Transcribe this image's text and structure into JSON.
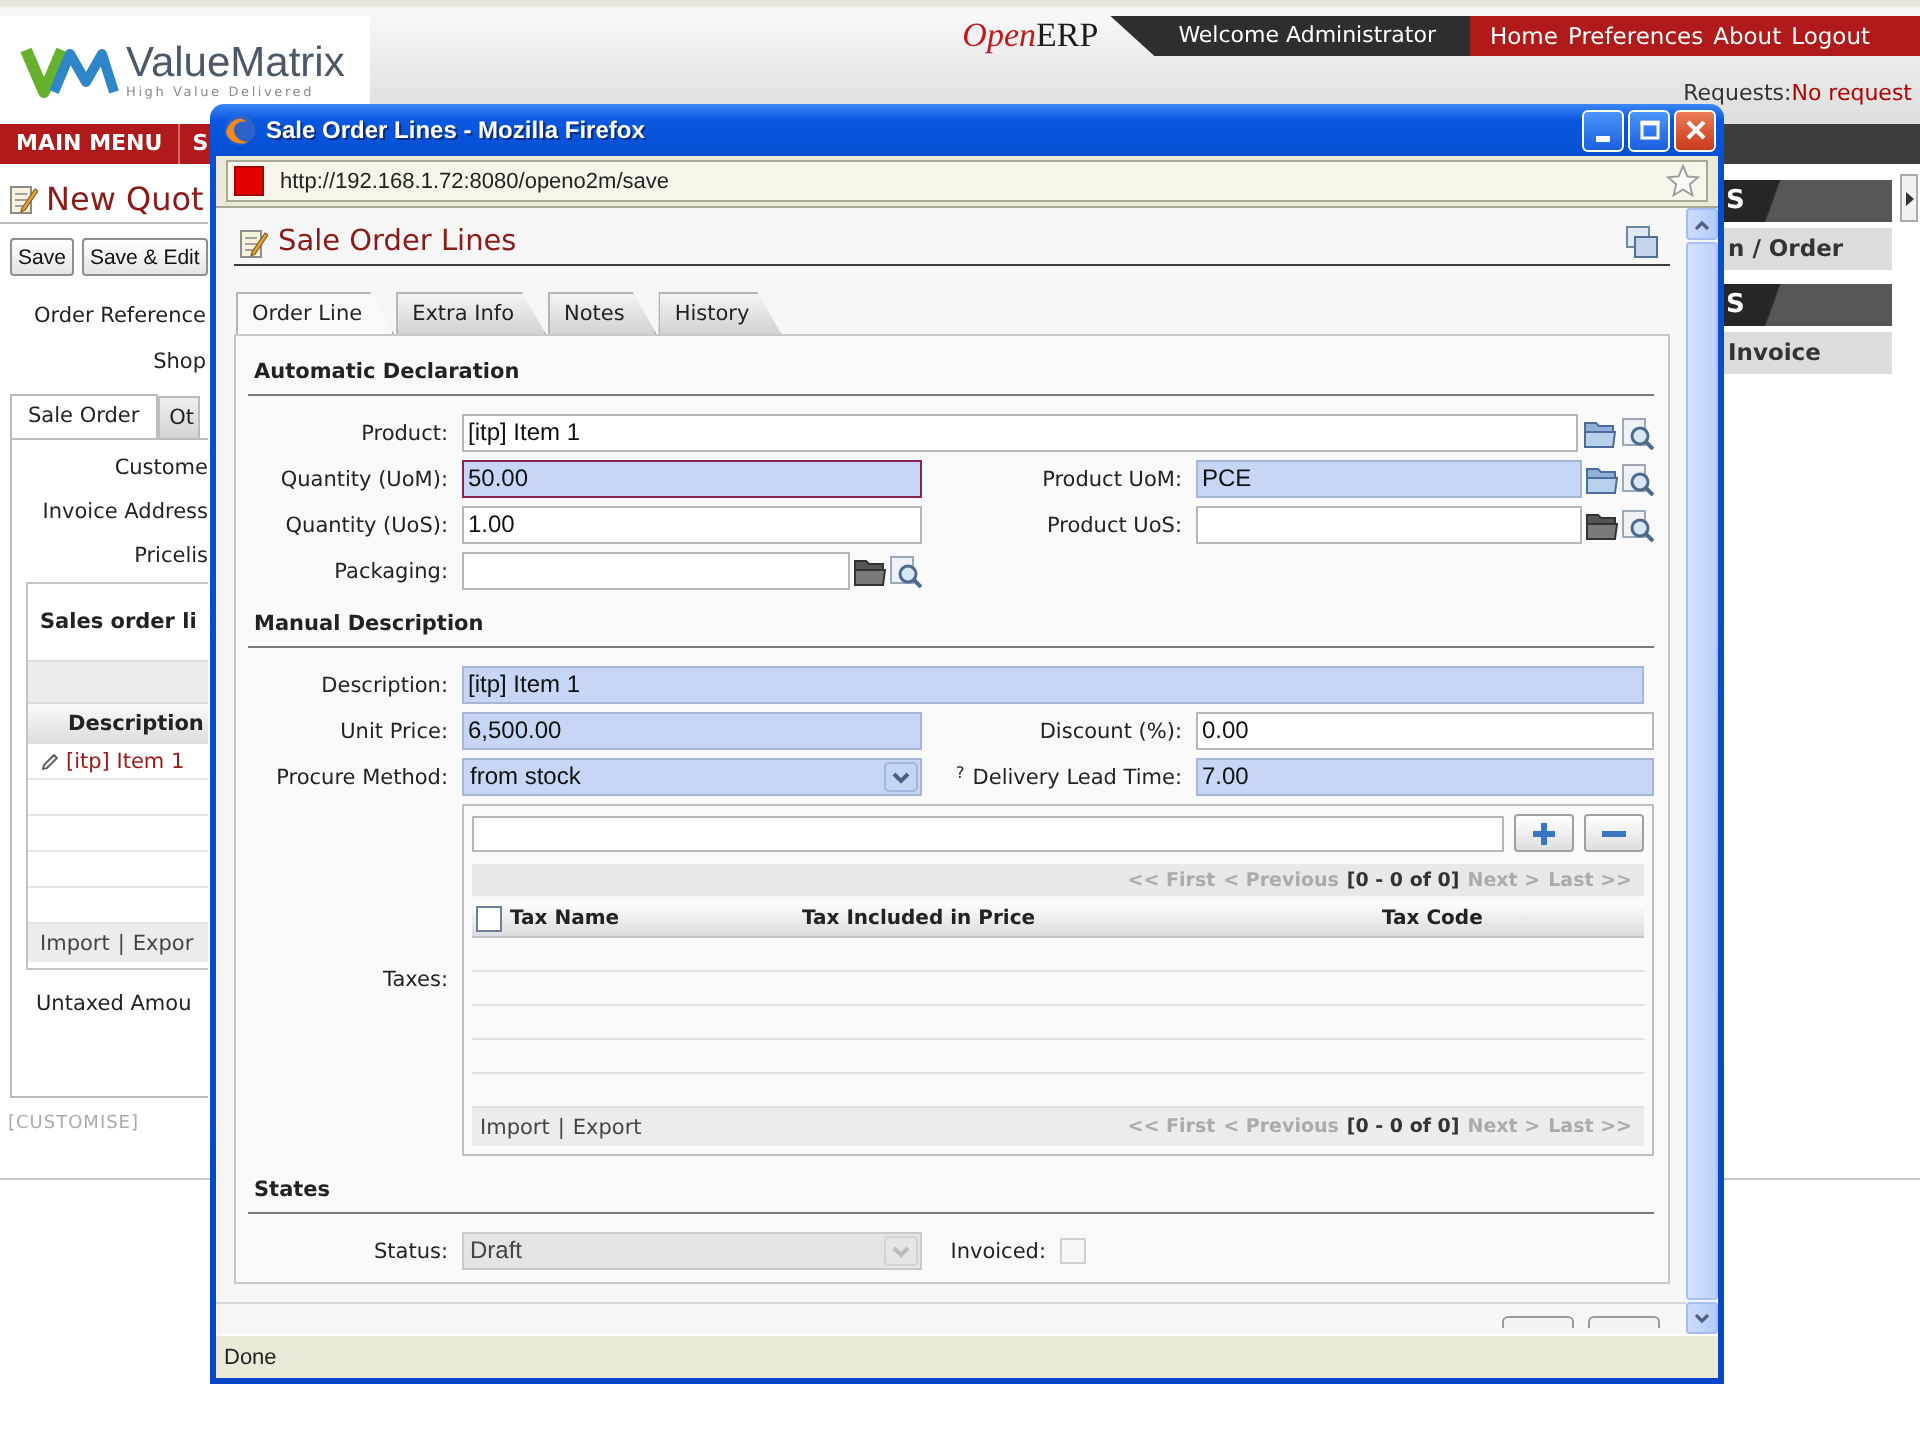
{
  "background_page": {
    "logo": {
      "name": "ValueMatrix",
      "tagline": "High Value Delivered"
    },
    "brand": [
      "Open",
      "ERP"
    ],
    "welcome": "Welcome Administrator",
    "nav_links": [
      "Home",
      "Preferences",
      "About",
      "Logout"
    ],
    "requests": {
      "label": "Requests:",
      "value": "No request"
    },
    "main_menu": [
      "MAIN MENU",
      "S"
    ],
    "title": "New Quot",
    "toolbar": [
      "Save",
      "Save & Edit"
    ],
    "header_fields": [
      "Order Reference",
      "Shop"
    ],
    "tabs": [
      {
        "label": "Sale Order",
        "selected": true
      },
      {
        "label": "Ot",
        "selected": false
      }
    ],
    "fields": [
      "Custome",
      "Invoice Address",
      "Pricelis"
    ],
    "order_lines": {
      "title": "Sales order li",
      "column": "Description",
      "rows": [
        "[itp] Item 1"
      ],
      "import": "Import",
      "separator": "|",
      "export": "Expor"
    },
    "untaxed": "Untaxed Amou",
    "customise": "[CUSTOMISE]",
    "sidebar": [
      {
        "heading": "S",
        "item": "n / Order"
      },
      {
        "heading": "S",
        "item": "Invoice"
      }
    ]
  },
  "popup": {
    "title": "Sale Order Lines - Mozilla Firefox",
    "url": "http://192.168.1.72:8080/openo2m/save",
    "heading": "Sale Order Lines",
    "tabs": [
      {
        "label": "Order Line",
        "selected": true
      },
      {
        "label": "Extra Info",
        "selected": false
      },
      {
        "label": "Notes",
        "selected": false
      },
      {
        "label": "History",
        "selected": false
      }
    ],
    "sections": [
      {
        "title": "Automatic Declaration",
        "rows": [
          {
            "full": {
              "label": "Product:",
              "kind": "many2one",
              "value": "[itp] Item 1",
              "required": false,
              "focused": false,
              "disabled": false
            }
          },
          {
            "left": {
              "label": "Quantity (UoM):",
              "kind": "char",
              "value": "50.00",
              "required": true,
              "focused": true,
              "disabled": false
            },
            "right": {
              "label": "Product UoM:",
              "kind": "many2one",
              "value": "PCE",
              "required": true,
              "focused": false,
              "disabled": false
            }
          },
          {
            "left": {
              "label": "Quantity (UoS):",
              "kind": "char",
              "value": "1.00",
              "required": false,
              "focused": false,
              "disabled": false
            },
            "right": {
              "label": "Product UoS:",
              "kind": "many2one",
              "required": false,
              "focused": false,
              "disabled": false
            }
          },
          {
            "left": {
              "label": "Packaging:",
              "kind": "many2one",
              "required": false,
              "focused": false,
              "disabled": false
            }
          }
        ]
      },
      {
        "title": "Manual Description",
        "rows": [
          {
            "full": {
              "label": "Description:",
              "kind": "char",
              "value": "[itp] Item 1",
              "required": true,
              "focused": false,
              "disabled": false
            }
          },
          {
            "left": {
              "label": "Unit Price:",
              "kind": "char",
              "value": "6,500.00",
              "required": true,
              "focused": false,
              "disabled": false
            },
            "right": {
              "label": "Discount (%):",
              "kind": "char",
              "value": "0.00",
              "required": false,
              "focused": false,
              "disabled": false
            }
          },
          {
            "left": {
              "label": "Procure Method:",
              "kind": "select",
              "value": "from stock",
              "required": true,
              "focused": false,
              "disabled": false
            },
            "right": {
              "label": "Delivery Lead Time:",
              "help_mark": "?",
              "kind": "char",
              "value": "7.00",
              "required": true,
              "focused": false,
              "disabled": false
            }
          },
          {
            "full": {
              "label": "Taxes:",
              "kind": "one2many",
              "select_all_checked": false,
              "top_pager": {
                "links_before": [
                  {
                    "text": "<< First",
                    "disabled": true
                  },
                  {
                    "text": "< Previous",
                    "disabled": true
                  }
                ],
                "range": "[0 - 0 of 0]",
                "links_after": [
                  {
                    "text": "Next >",
                    "disabled": true
                  },
                  {
                    "text": "Last >>",
                    "disabled": true
                  }
                ]
              },
              "columns": [
                "Tax Name",
                "Tax Included in Price",
                "Tax Code"
              ],
              "import": "Import",
              "separator": "|",
              "export": "Export",
              "bottom_pager": {
                "links_before": [
                  {
                    "text": "<< First",
                    "disabled": true
                  },
                  {
                    "text": "< Previous",
                    "disabled": true
                  }
                ],
                "range": "[0 - 0 of 0]",
                "links_after": [
                  {
                    "text": "Next >",
                    "disabled": true
                  },
                  {
                    "text": "Last >>",
                    "disabled": true
                  }
                ]
              }
            }
          }
        ]
      },
      {
        "title": "States",
        "rows": [
          {
            "left": {
              "label": "Status:",
              "kind": "select",
              "value": "Draft",
              "required": false,
              "focused": false,
              "disabled": true
            },
            "right": {
              "label": "Invoiced:",
              "kind": "checkbox",
              "checked": false,
              "disabled": true
            }
          }
        ]
      }
    ],
    "status": "Done"
  }
}
